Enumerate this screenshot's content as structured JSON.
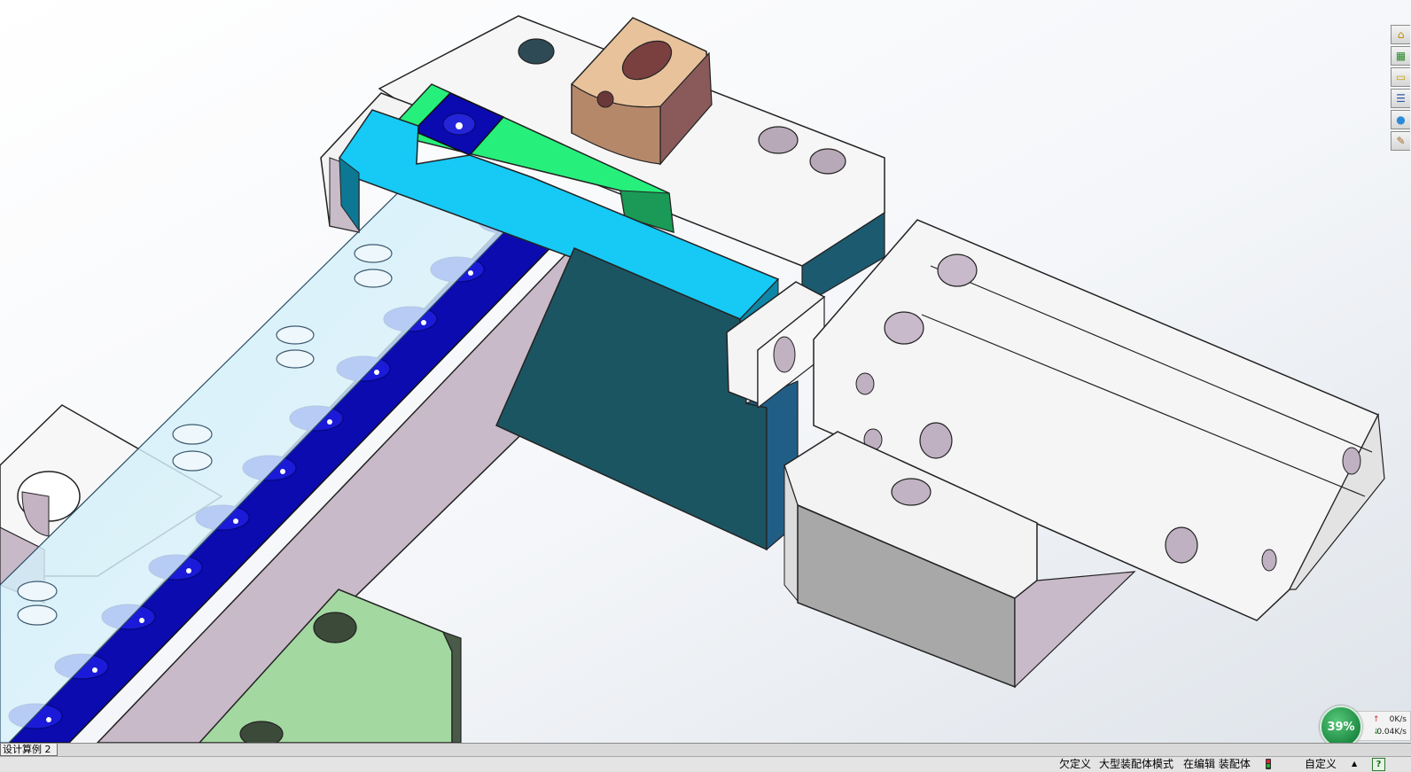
{
  "document": {
    "tab_label": "设计算例 2"
  },
  "statusbar": {
    "definition_state": "欠定义",
    "large_assembly_mode": "大型装配体模式",
    "editing": "在编辑 装配体",
    "units": "自定义",
    "units_arrow": "▲",
    "help": "?"
  },
  "net_widget": {
    "percent": "39%",
    "upload": "0K/s",
    "download": "0.04K/s",
    "up_arrow": "↑",
    "down_arrow": "↓"
  },
  "taskpane": {
    "tabs": [
      {
        "icon": "home-icon",
        "glyph": "⌂"
      },
      {
        "icon": "design-library-icon",
        "glyph": "▦"
      },
      {
        "icon": "file-explorer-icon",
        "glyph": "▭"
      },
      {
        "icon": "view-palette-icon",
        "glyph": "☰"
      },
      {
        "icon": "appearances-icon",
        "glyph": "●"
      },
      {
        "icon": "custom-properties-icon",
        "glyph": "✎"
      }
    ]
  },
  "colors": {
    "cyan_block": "#17c9f5",
    "green_block": "#23f27a",
    "navy_track": "#0a0aa8",
    "teal_block": "#1c5562",
    "tan_clamp": "#e8c29b",
    "grey_cylinder": "#c6c6c6",
    "lavender_side": "#c8b9c8",
    "sage_block": "#a3d9a0"
  }
}
